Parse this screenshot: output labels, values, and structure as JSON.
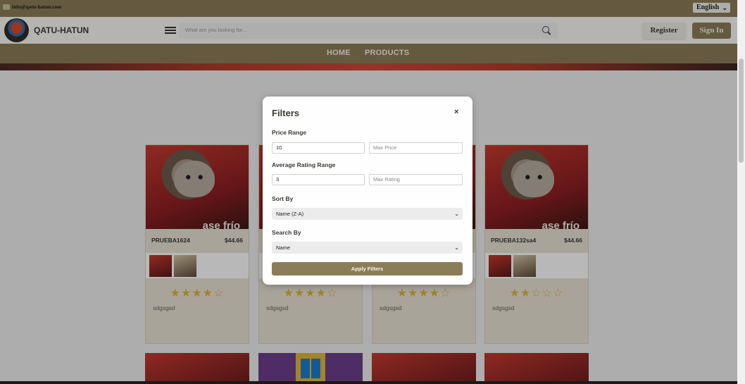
{
  "topbar": {
    "email": "info@qatu-hatun.com",
    "language": "English"
  },
  "header": {
    "brand": "QATU-HATUN",
    "search_placeholder": "What are you looking for...",
    "register_label": "Register",
    "signin_label": "Sign In"
  },
  "nav": {
    "items": [
      "HOME",
      "PRODUCTS"
    ]
  },
  "colors": {
    "brand": "#8c7d59",
    "star": "#e0b63a"
  },
  "products": [
    {
      "name": "PRUEBA1624",
      "price": "$44.66",
      "stars": "★★★★☆",
      "description": "sdgsgsd",
      "image_caption": "ase frío"
    },
    {
      "name": "",
      "price": "",
      "stars": "★★★★☆",
      "description": "sdgsgsd",
      "image_caption": ""
    },
    {
      "name": "",
      "price": "",
      "stars": "★★★★☆",
      "description": "sdgsgsd",
      "image_caption": ""
    },
    {
      "name": "PRUEBA132sa4",
      "price": "$44.66",
      "stars": "★★☆☆☆",
      "description": "sdgsgsd",
      "image_caption": "ase frío"
    }
  ],
  "filters": {
    "title": "Filters",
    "close_symbol": "×",
    "price_range_label": "Price Range",
    "min_price_value": "10",
    "max_price_placeholder": "Max Price",
    "rating_range_label": "Average Rating Range",
    "min_rating_value": "3",
    "max_rating_placeholder": "Max Rating",
    "sort_by_label": "Sort By",
    "sort_by_value": "Name (Z-A)",
    "search_by_label": "Search By",
    "search_by_value": "Name",
    "apply_label": "Apply Filters"
  }
}
